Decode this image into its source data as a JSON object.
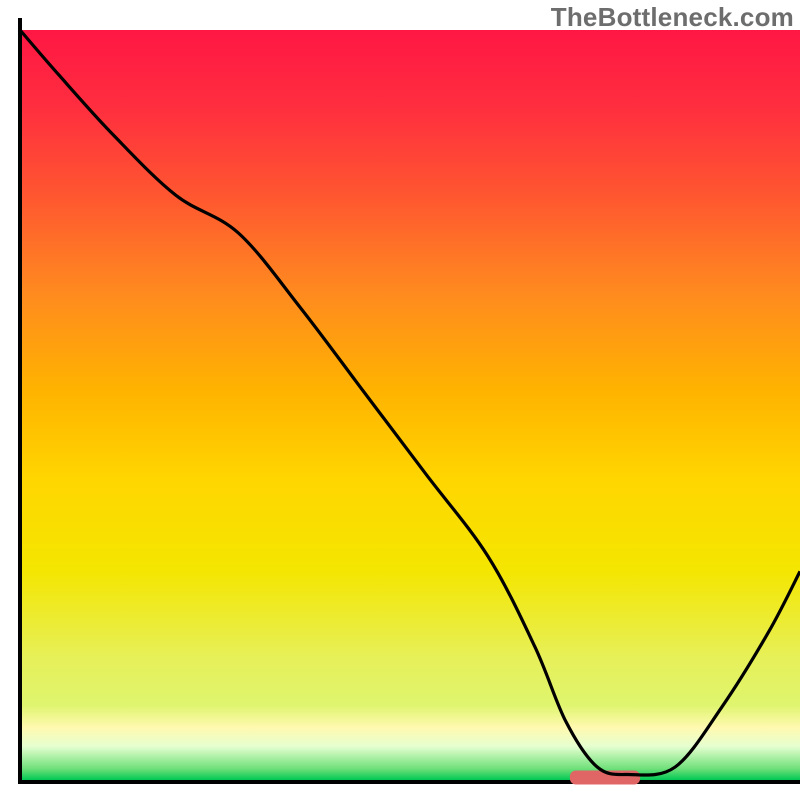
{
  "watermark": "TheBottleneck.com",
  "chart_data": {
    "type": "line",
    "title": "",
    "xlabel": "",
    "ylabel": "",
    "xlim": [
      0,
      100
    ],
    "ylim": [
      0,
      100
    ],
    "x": [
      0,
      5,
      12,
      20,
      28,
      36,
      44,
      52,
      60,
      66,
      70,
      74,
      78,
      84,
      90,
      96,
      100
    ],
    "values": [
      100,
      94,
      86,
      78,
      73,
      63,
      52,
      41,
      30,
      18,
      8,
      2,
      1,
      2,
      10,
      20,
      28
    ],
    "marker": {
      "x_start": 70.5,
      "x_end": 79.5,
      "y": 0.6,
      "color": "#e06666"
    },
    "gradient_stops": [
      {
        "offset": 0.0,
        "color": "#ff1744"
      },
      {
        "offset": 0.1,
        "color": "#ff2d3f"
      },
      {
        "offset": 0.22,
        "color": "#ff5630"
      },
      {
        "offset": 0.35,
        "color": "#ff8a1f"
      },
      {
        "offset": 0.48,
        "color": "#ffb300"
      },
      {
        "offset": 0.6,
        "color": "#ffd600"
      },
      {
        "offset": 0.72,
        "color": "#f4e600"
      },
      {
        "offset": 0.84,
        "color": "#e6f05a"
      },
      {
        "offset": 0.9,
        "color": "#dff56e"
      },
      {
        "offset": 0.93,
        "color": "#fff9b0"
      },
      {
        "offset": 0.955,
        "color": "#e6ffd0"
      },
      {
        "offset": 0.985,
        "color": "#6fe07a"
      },
      {
        "offset": 1.0,
        "color": "#00c853"
      }
    ],
    "axis_color": "#000000",
    "line_color": "#000000"
  }
}
